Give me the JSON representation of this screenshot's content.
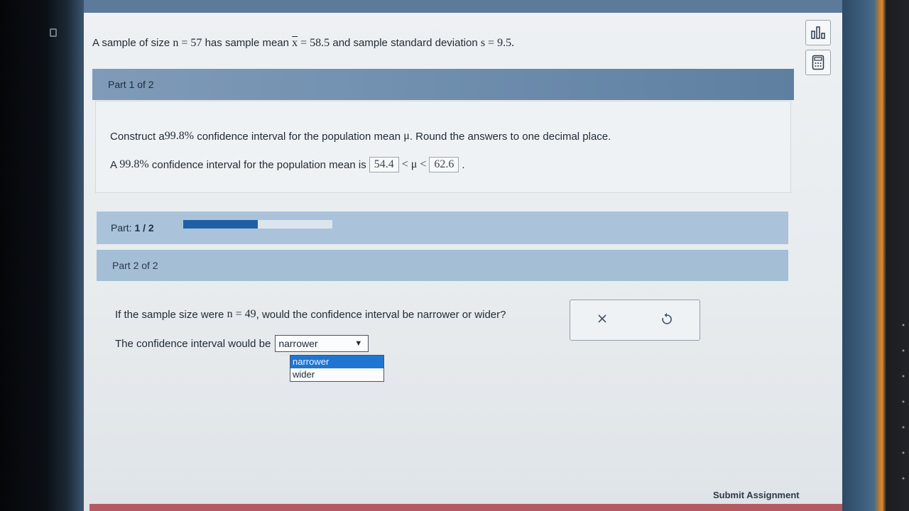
{
  "problem": {
    "text_1": "A sample of size ",
    "n_expr": "n = 57",
    "text_2": " has sample mean ",
    "mean_var": "x",
    "mean_val": " = 58.5",
    "text_3": " and sample standard deviation ",
    "sd_expr": "s = 9.5",
    "period": "."
  },
  "part1": {
    "header": "Part 1 of 2",
    "prompt_a": "Construct a ",
    "prompt_pct": "99.8%",
    "prompt_b": " confidence interval for the population mean ",
    "prompt_mu": "μ",
    "prompt_c": ". Round the answers to one decimal place.",
    "answer_a": "A ",
    "answer_pct": "99.8%",
    "answer_b": " confidence interval for the population mean is",
    "lower": "54.4",
    "middle": "< μ <",
    "upper": "62.6",
    "end": "."
  },
  "progress": {
    "label": "Part:",
    "value": "1 / 2",
    "fraction": 0.5
  },
  "part2": {
    "header": "Part 2 of 2",
    "question_a": "If the sample size were ",
    "question_n": "n = 49",
    "question_b": ", would the confidence interval be narrower or wider?",
    "answer_label": "The confidence interval would be",
    "selected": "narrower",
    "options": [
      "narrower",
      "wider"
    ]
  },
  "checker": {
    "clear_icon": "x-icon",
    "reset_icon": "undo-icon"
  },
  "tools": {
    "stats_icon": "bar-chart-icon",
    "calc_icon": "calculator-icon"
  },
  "footer": {
    "submit_label": "Submit Assignment"
  },
  "colors": {
    "accent_blue": "#1f75d0",
    "progress_fill": "#1f5fa6",
    "header_blue": "#6f8eae"
  }
}
